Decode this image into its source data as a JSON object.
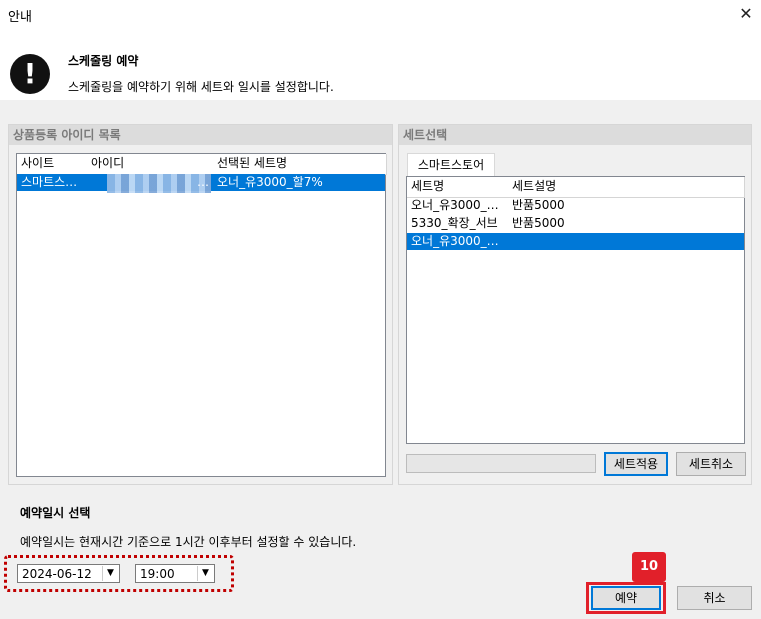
{
  "window": {
    "title": "안내",
    "close_glyph": "✕"
  },
  "header": {
    "title": "스케줄링 예약",
    "description": "스케줄링을 예약하기 위해 세트와 일시를 설정합니다."
  },
  "left_panel": {
    "title": "상품등록 아이디 목록",
    "columns": [
      "사이트",
      "아이디",
      "선택된 세트명"
    ],
    "rows": [
      {
        "site": "스마트스…",
        "id_suffix": "…",
        "set_name": "오너_유3000_할7%"
      }
    ]
  },
  "right_panel": {
    "title": "세트선택",
    "tab_label": "스마트스토어",
    "columns": [
      "세트명",
      "세트설명"
    ],
    "rows": [
      {
        "name": "오너_유3000_…",
        "desc": "반품5000"
      },
      {
        "name": "5330_확장_서브",
        "desc": "반품5000"
      },
      {
        "name": "오너_유3000_…",
        "desc": ""
      }
    ],
    "apply_button": "세트적용",
    "cancel_set_button": "세트취소"
  },
  "schedule": {
    "title": "예약일시 선택",
    "description": "예약일시는 현재시간 기준으로 1시간 이후부터 설정할 수 있습니다.",
    "date_value": "2024-06-12",
    "time_value": "19:00"
  },
  "footer": {
    "reserve_button": "예약",
    "cancel_button": "취소",
    "step_badge": "10"
  }
}
